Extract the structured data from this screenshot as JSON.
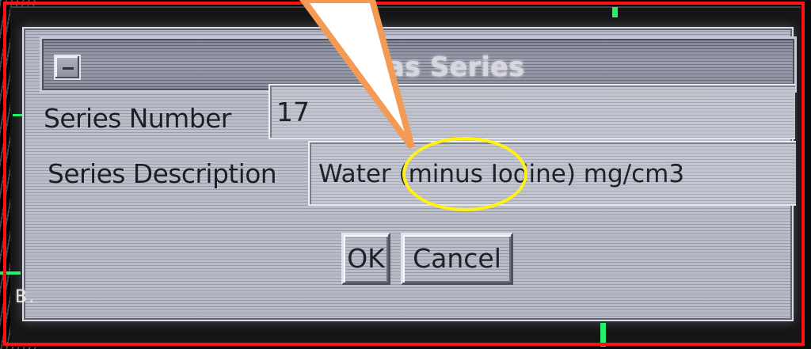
{
  "dialog": {
    "title": "e as Series",
    "series_number_label": "Series Number",
    "series_number_value": "17",
    "series_description_label": "Series Description",
    "series_description_value": "Water (minus Iodine) mg/cm3",
    "ok_label": "OK",
    "cancel_label": "Cancel"
  },
  "background": {
    "left_edge_text": "B."
  },
  "annotation": {
    "arrow_color": "#f39a55",
    "highlight_color": "#fff213",
    "frame_color": "#ff1111"
  }
}
